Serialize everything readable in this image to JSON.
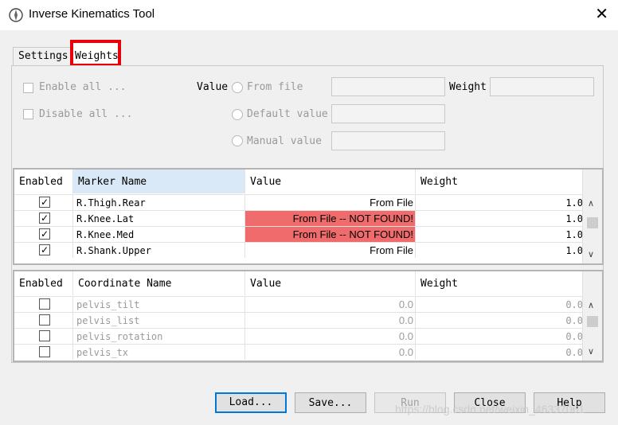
{
  "window": {
    "title": "Inverse Kinematics Tool",
    "close_glyph": "✕"
  },
  "tabs": [
    {
      "label": "Settings"
    },
    {
      "label": "Weights"
    }
  ],
  "weights_panel": {
    "enable_all": "Enable all ...",
    "disable_all": "Disable all ...",
    "value_label": "Value",
    "from_file": "From file",
    "default_value": "Default value",
    "manual_value": "Manual value",
    "weight_label": "Weight"
  },
  "marker_table": {
    "headers": [
      "Enabled",
      "Marker Name",
      "Value",
      "Weight"
    ],
    "rows": [
      {
        "checked": "✓",
        "name": "R.Thigh.Rear",
        "value": "From File",
        "weight": "1.0",
        "missing": false
      },
      {
        "checked": "✓",
        "name": "R.Knee.Lat",
        "value": "From File -- NOT FOUND!",
        "weight": "1.0",
        "missing": true
      },
      {
        "checked": "✓",
        "name": "R.Knee.Med",
        "value": "From File -- NOT FOUND!",
        "weight": "1.0",
        "missing": true
      },
      {
        "checked": "✓",
        "name": "R.Shank.Upper",
        "value": "From File",
        "weight": "1.0",
        "missing": false
      }
    ]
  },
  "coordinate_table": {
    "headers": [
      "Enabled",
      "Coordinate Name",
      "Value",
      "Weight"
    ],
    "rows": [
      {
        "checked": "",
        "name": "pelvis_tilt",
        "value": "0.0",
        "weight": "0.0"
      },
      {
        "checked": "",
        "name": "pelvis_list",
        "value": "0.0",
        "weight": "0.0"
      },
      {
        "checked": "",
        "name": "pelvis_rotation",
        "value": "0.0",
        "weight": "0.0"
      },
      {
        "checked": "",
        "name": "pelvis_tx",
        "value": "0.0",
        "weight": "0.0"
      }
    ]
  },
  "scroll": {
    "up": "∧",
    "down": "∨"
  },
  "buttons": {
    "load": "Load...",
    "save": "Save...",
    "run": "Run",
    "close": "Close",
    "help": "Help"
  },
  "watermark": "https://blog.csdn.net/weixin_46337061",
  "colors": {
    "highlight_border": "#e8000b",
    "not_found_bg": "#f06b6b",
    "selected_header": "#d9e9f7"
  }
}
